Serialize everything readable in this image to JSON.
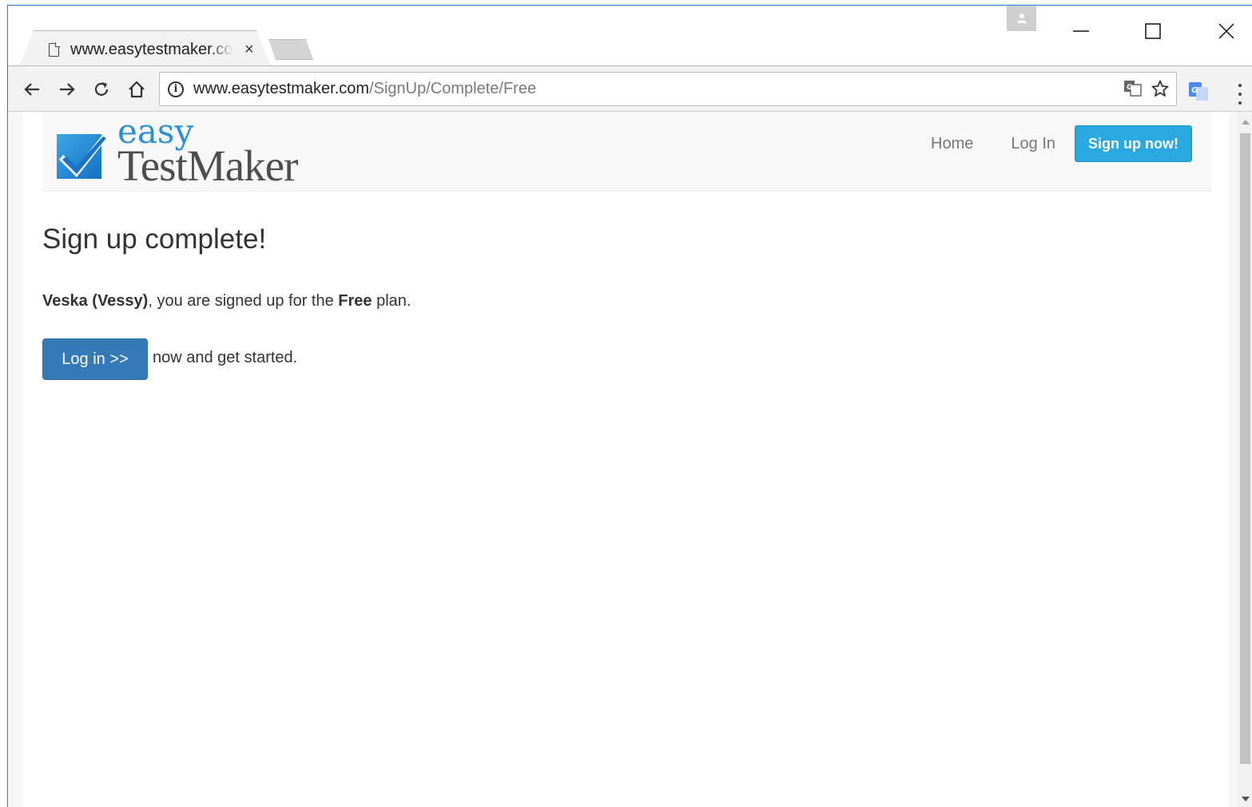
{
  "browser": {
    "tab_title": "www.easytestmaker.com/SignUp/Complete/Free",
    "tab_close": "×",
    "url_host": "www.easytestmaker.com",
    "url_path": "/SignUp/Complete/Free",
    "info_icon": "i"
  },
  "site": {
    "logo_easy": "easy",
    "logo_testmaker": "TestMaker",
    "nav": {
      "home": "Home",
      "login": "Log In",
      "signup": "Sign up now!"
    },
    "brand_color": "#2aa8e0"
  },
  "main": {
    "heading": "Sign up complete!",
    "user_name": "Veska (Vessy)",
    "msg_middle": ", you are signed up for the ",
    "plan": "Free",
    "msg_end": " plan.",
    "login_button": "Log in >>",
    "cta_text": "now and get started.",
    "button_color": "#337ab7"
  }
}
